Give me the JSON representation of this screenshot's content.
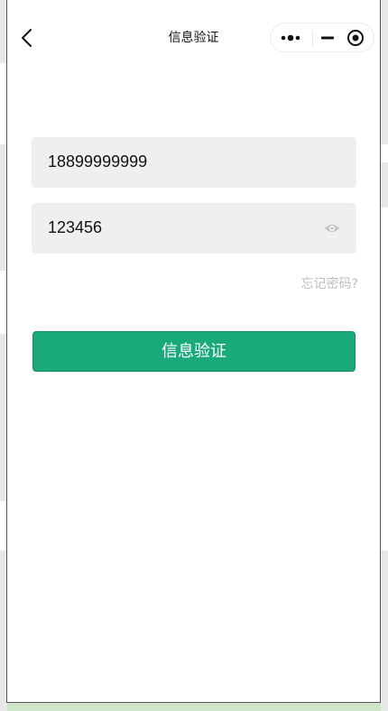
{
  "navbar": {
    "title": "信息验证",
    "back_icon": "chevron-left-icon",
    "capsule": {
      "more_icon": "more-dots-icon",
      "minimize_icon": "minimize-icon",
      "close_icon": "target-close-icon"
    }
  },
  "form": {
    "phone_value": "18899999999",
    "password_value": "123456",
    "eye_icon": "eye-icon",
    "forgot_label": "忘记密码?",
    "submit_label": "信息验证"
  },
  "colors": {
    "primary": "#1aa97a",
    "field_bg": "#efefef",
    "muted_text": "#bdbdbd",
    "backdrop": "#cfe5c9"
  }
}
